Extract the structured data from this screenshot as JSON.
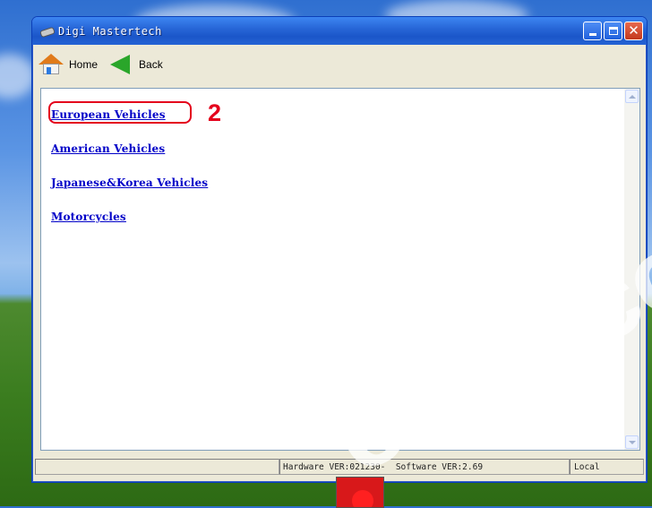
{
  "window": {
    "title": "Digi Mastertech"
  },
  "toolbar": {
    "home_label": "Home",
    "back_label": "Back"
  },
  "content": {
    "links": [
      {
        "label": "European Vehicles"
      },
      {
        "label": "American Vehicles"
      },
      {
        "label": "Japanese&Korea Vehicles"
      },
      {
        "label": "Motorcycles"
      }
    ],
    "annotation_number": "2"
  },
  "statusbar": {
    "cell_1": "",
    "version": "Hardware VER:021230-  Software VER:2.69",
    "mode": "Local"
  },
  "watermark": "obd2.co",
  "colors": {
    "link": "#0000c8",
    "annotation": "#e4001c",
    "titlebar": "#2867d8"
  },
  "icons": {
    "title": "obd-cable-icon",
    "home": "home-icon",
    "back": "back-arrow-icon"
  }
}
